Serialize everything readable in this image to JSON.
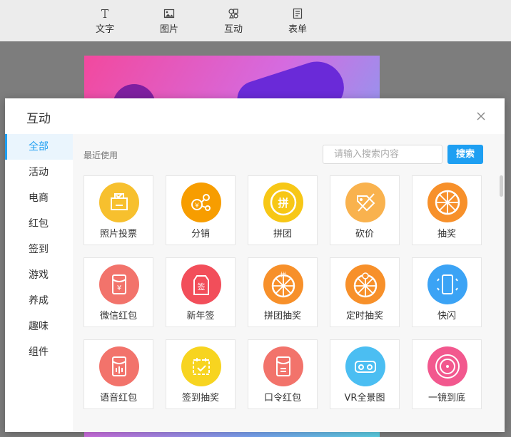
{
  "toolbar": {
    "items": [
      {
        "label": "文字",
        "icon": "text-icon"
      },
      {
        "label": "图片",
        "icon": "image-icon"
      },
      {
        "label": "互动",
        "icon": "interaction-icon"
      },
      {
        "label": "表单",
        "icon": "form-icon"
      }
    ]
  },
  "modal": {
    "title": "互动",
    "sidebar": [
      "全部",
      "活动",
      "电商",
      "红包",
      "签到",
      "游戏",
      "养成",
      "趣味",
      "组件"
    ],
    "recent_label": "最近使用",
    "search": {
      "placeholder": "请输入搜索内容",
      "button": "搜索"
    },
    "cards": [
      {
        "label": "照片投票",
        "icon": "photo-vote-icon",
        "color": "#f7c02e"
      },
      {
        "label": "分销",
        "icon": "distribution-icon",
        "color": "#f79d00"
      },
      {
        "label": "拼团",
        "icon": "group-buy-icon",
        "color": "#f7c716"
      },
      {
        "label": "砍价",
        "icon": "bargain-icon",
        "color": "#f9b24e"
      },
      {
        "label": "抽奖",
        "icon": "lottery-icon",
        "color": "#f7902a"
      },
      {
        "label": "微信红包",
        "icon": "wechat-red-packet-icon",
        "color": "#f2736b"
      },
      {
        "label": "新年签",
        "icon": "new-year-sign-icon",
        "color": "#f24e5a"
      },
      {
        "label": "拼团抽奖",
        "icon": "group-lottery-icon",
        "color": "#f7902a"
      },
      {
        "label": "定时抽奖",
        "icon": "timed-lottery-icon",
        "color": "#f7902a"
      },
      {
        "label": "快闪",
        "icon": "flash-icon",
        "color": "#3ba3f5"
      },
      {
        "label": "语音红包",
        "icon": "voice-red-packet-icon",
        "color": "#f2736b"
      },
      {
        "label": "签到抽奖",
        "icon": "checkin-lottery-icon",
        "color": "#f7d420"
      },
      {
        "label": "口令红包",
        "icon": "password-red-packet-icon",
        "color": "#f2736b"
      },
      {
        "label": "VR全景图",
        "icon": "vr-panorama-icon",
        "color": "#4bbef2"
      },
      {
        "label": "一镜到底",
        "icon": "one-shot-icon",
        "color": "#f2588e"
      }
    ]
  },
  "colors": {
    "accent": "#1e9ff2"
  }
}
